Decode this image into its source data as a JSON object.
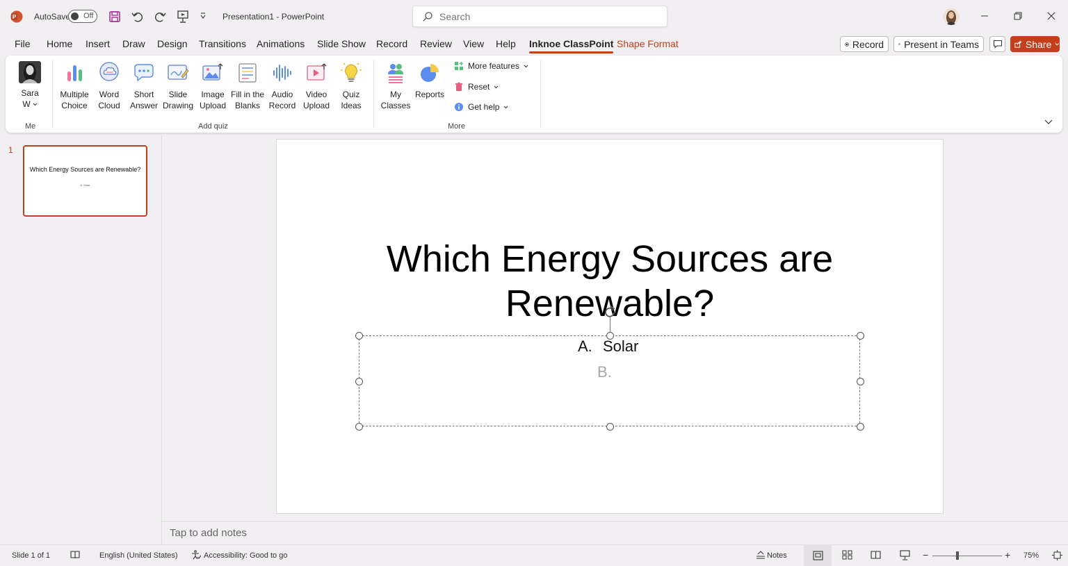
{
  "titlebar": {
    "autosave_label": "AutoSave",
    "autosave_state": "Off",
    "doc_title": "Presentation1  -  PowerPoint",
    "search_placeholder": "Search"
  },
  "menu": {
    "tabs": [
      "File",
      "Home",
      "Insert",
      "Draw",
      "Design",
      "Transitions",
      "Animations",
      "Slide Show",
      "Record",
      "Review",
      "View",
      "Help",
      "Inknoe ClassPoint",
      "Shape Format"
    ],
    "active": "Inknoe ClassPoint",
    "record_btn": "Record",
    "present_teams_btn": "Present in Teams",
    "share_btn": "Share"
  },
  "ribbon": {
    "me_line1": "Sara",
    "me_line2": "W",
    "me_group": "Me",
    "add_quiz_group": "Add quiz",
    "more_group": "More",
    "buttons": [
      {
        "l1": "Multiple",
        "l2": "Choice"
      },
      {
        "l1": "Word",
        "l2": "Cloud"
      },
      {
        "l1": "Short",
        "l2": "Answer"
      },
      {
        "l1": "Slide",
        "l2": "Drawing"
      },
      {
        "l1": "Image",
        "l2": "Upload"
      },
      {
        "l1": "Fill in the",
        "l2": "Blanks"
      },
      {
        "l1": "Audio",
        "l2": "Record"
      },
      {
        "l1": "Video",
        "l2": "Upload"
      },
      {
        "l1": "Quiz",
        "l2": "Ideas"
      }
    ],
    "my_classes_l1": "My",
    "my_classes_l2": "Classes",
    "reports": "Reports",
    "more_features": "More features",
    "reset": "Reset",
    "get_help": "Get help"
  },
  "slides_panel": {
    "number": "1",
    "thumb_title": "Which Energy Sources are Renewable?",
    "thumb_option": "A.   Solar"
  },
  "slide": {
    "title_line1": "Which Energy Sources are",
    "title_line2": "Renewable?",
    "option_a_letter": "A.",
    "option_a_text": "Solar",
    "option_b_letter": "B."
  },
  "notes_placeholder": "Tap to add notes",
  "status": {
    "slide_count": "Slide 1 of 1",
    "language": "English (United States)",
    "accessibility": "Accessibility: Good to go",
    "notes": "Notes",
    "zoom_minus": "−",
    "zoom_plus": "+",
    "zoom_level": "75%"
  },
  "colors": {
    "accent": "#c43e1c",
    "ribbon_bg": "#ffffff",
    "app_bg": "#f2eff2"
  },
  "icons": [
    "powerpoint-logo-icon",
    "save-icon",
    "undo-icon",
    "redo-icon",
    "present-icon",
    "customize-icon",
    "search-icon",
    "minimize-icon",
    "restore-icon",
    "close-icon",
    "comments-icon",
    "expand-ribbon-icon",
    "reading-icon",
    "accessibility-icon",
    "normal-view-icon",
    "sorter-view-icon",
    "reading-view-icon",
    "slideshow-view-icon",
    "fit-slide-icon"
  ]
}
